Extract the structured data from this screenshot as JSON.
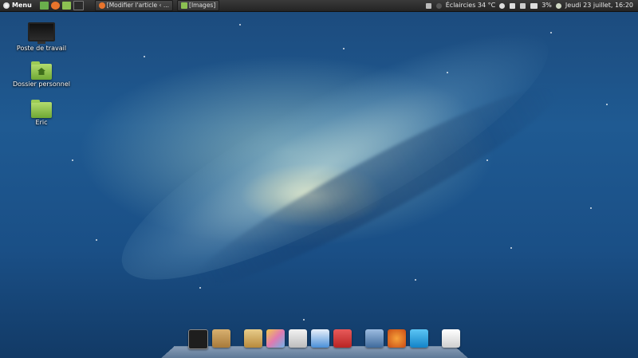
{
  "panel": {
    "menu_label": "Menu",
    "launchers": [
      {
        "name": "file-manager-icon",
        "color": "#6ab04c"
      },
      {
        "name": "firefox-icon",
        "color": "#e8742c"
      },
      {
        "name": "folder-icon",
        "color": "#8cc152"
      },
      {
        "name": "terminal-icon",
        "color": "#2b2b2b"
      }
    ],
    "tasks": [
      {
        "label": "[Modifier l'article ‹ ...",
        "icon": "firefox-icon",
        "color": "#e8742c"
      },
      {
        "label": "[Images]",
        "icon": "folder-icon",
        "color": "#8cc152"
      }
    ],
    "weather": "Éclaircies 34 °C",
    "battery": "3%",
    "datetime": "Jeudi 23 juillet, 16:20"
  },
  "desktop_icons": [
    {
      "label": "Poste de travail",
      "icon": "computer-icon"
    },
    {
      "label": "Dossier personnel",
      "icon": "home-folder-icon"
    },
    {
      "label": "Eric",
      "icon": "folder-icon"
    }
  ],
  "dock": [
    {
      "name": "terminal-icon",
      "color": "#1e1e1e"
    },
    {
      "name": "package-installer-icon",
      "color": "#c89b5a"
    },
    {
      "name": "text-editor-icon",
      "color": "#d8b26a"
    },
    {
      "name": "image-viewer-icon",
      "color": "#e07ab0"
    },
    {
      "name": "calculator-icon",
      "color": "#d9d9d9"
    },
    {
      "name": "document-writer-icon",
      "color": "#4a8fd8"
    },
    {
      "name": "office-app-icon",
      "color": "#d63a3a"
    },
    {
      "name": "mail-client-icon",
      "color": "#5a86b8"
    },
    {
      "name": "firefox-icon",
      "color": "#e8742c"
    },
    {
      "name": "skype-icon",
      "color": "#1ea0e8"
    },
    {
      "name": "system-settings-icon",
      "color": "#e6e6e6"
    }
  ]
}
